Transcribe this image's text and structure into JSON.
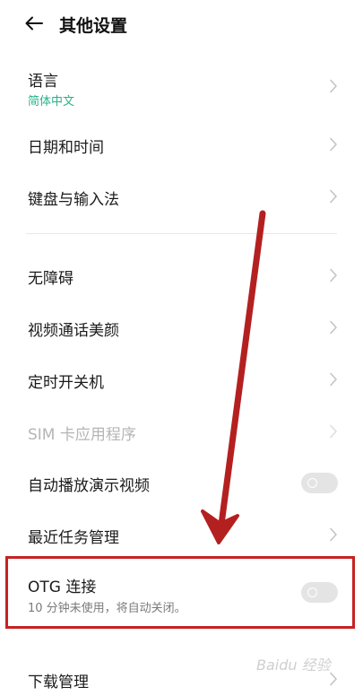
{
  "header": {
    "title": "其他设置",
    "back_icon": "arrow-left-icon"
  },
  "colors": {
    "accent": "#26b38a",
    "highlight_box": "#c62222",
    "annotation_arrow": "#b42020"
  },
  "items": [
    {
      "label": "语言",
      "sub": "简体中文"
    },
    {
      "label": "日期和时间"
    },
    {
      "label": "键盘与输入法"
    },
    {
      "label": "无障碍"
    },
    {
      "label": "视频通话美颜"
    },
    {
      "label": "定时开关机"
    },
    {
      "label": "SIM 卡应用程序"
    },
    {
      "label": "自动播放演示视频"
    },
    {
      "label": "最近任务管理"
    },
    {
      "label": "OTG 连接",
      "sub": "10 分钟未使用，将自动关闭。"
    },
    {
      "label": "下载管理"
    }
  ],
  "watermark": "Baidu 经验"
}
